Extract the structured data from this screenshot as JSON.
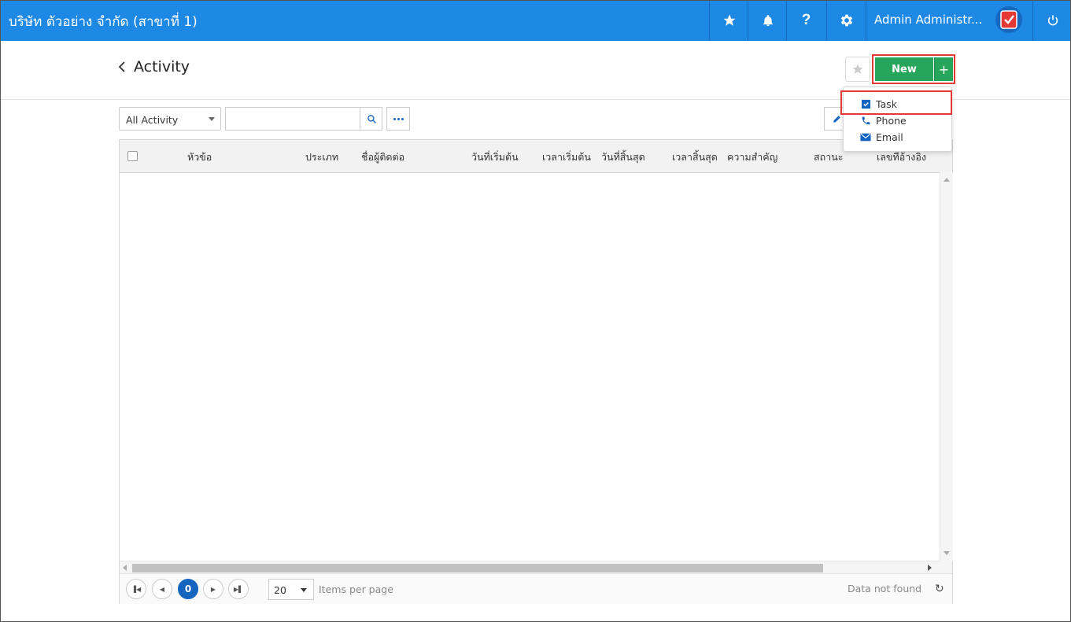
{
  "topbar": {
    "company": "บริษัท ตัวอย่าง จำกัด (สาขาที่ 1)",
    "username": "Admin Administr...",
    "icons": [
      "star-icon",
      "bell-icon",
      "help-icon",
      "gear-icon",
      "avatar",
      "power-icon"
    ],
    "bg_color": "#1e88e5"
  },
  "header": {
    "title": "Activity",
    "new_label": "New",
    "new_plus": "+"
  },
  "toolbar": {
    "filter_value": "All Activity",
    "search_value": "",
    "search_placeholder": ""
  },
  "grid": {
    "columns": [
      "หัวข้อ",
      "ประเภท",
      "ชื่อผู้ติดต่อ",
      "วันที่เริ่มต้น",
      "เวลาเริ่มต้น",
      "วันที่สิ้นสุด",
      "เวลาสิ้นสุด",
      "ความสำคัญ",
      "สถานะ",
      "เลขที่อ้างอิง"
    ],
    "rows": []
  },
  "pager": {
    "current_page": "0",
    "page_size": "20",
    "items_per_page": "Items per page",
    "status": "Data not found"
  },
  "new_menu": {
    "items": [
      {
        "label": "Task",
        "icon": "task-icon"
      },
      {
        "label": "Phone",
        "icon": "phone-icon"
      },
      {
        "label": "Email",
        "icon": "email-icon"
      }
    ],
    "highlighted": "Task"
  },
  "colors": {
    "accent": "#1e88e5",
    "new_button": "#26a65b",
    "highlight": "#e53935",
    "page_active": "#1565c0"
  }
}
